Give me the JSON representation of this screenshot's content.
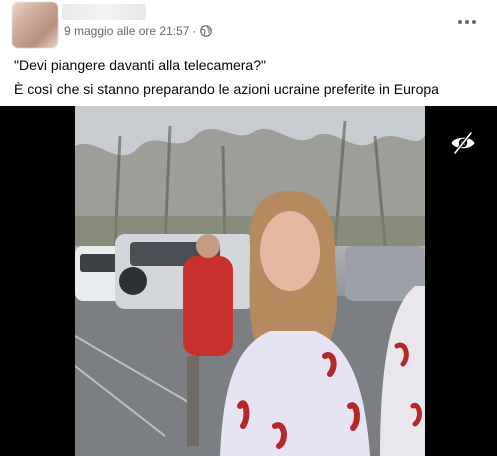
{
  "post": {
    "author": {
      "avatar_icon": "avatar-blurred"
    },
    "meta": {
      "date": "9 maggio alle ore 21:57",
      "separator": "·",
      "audience_icon": "globe-icon"
    },
    "menu_icon": "more-options-icon",
    "text_lines": [
      "\"Devi piangere davanti alla telecamera?\"",
      "È così che si stanno preparando le azioni ucraine preferite in Europa"
    ],
    "media": {
      "type": "video",
      "overlay_icon": "eye-icon"
    }
  },
  "colors": {
    "secondary_text": "#65676b",
    "media_background": "#000000"
  }
}
